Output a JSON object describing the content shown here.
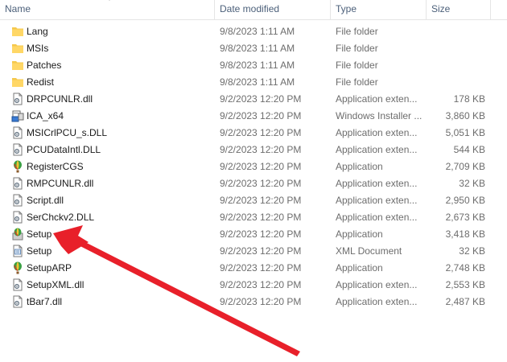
{
  "columns": {
    "name": "Name",
    "date": "Date modified",
    "type": "Type",
    "size": "Size"
  },
  "colors": {
    "folder": "#f5c84c",
    "arrow": "#e8202a",
    "header_text": "#4c607a"
  },
  "files": [
    {
      "name": "Lang",
      "date": "9/8/2023 1:11 AM",
      "type": "File folder",
      "size": "",
      "icon": "folder-icon"
    },
    {
      "name": "MSIs",
      "date": "9/8/2023 1:11 AM",
      "type": "File folder",
      "size": "",
      "icon": "folder-icon"
    },
    {
      "name": "Patches",
      "date": "9/8/2023 1:11 AM",
      "type": "File folder",
      "size": "",
      "icon": "folder-icon"
    },
    {
      "name": "Redist",
      "date": "9/8/2023 1:11 AM",
      "type": "File folder",
      "size": "",
      "icon": "folder-icon"
    },
    {
      "name": "DRPCUNLR.dll",
      "date": "9/2/2023 12:20 PM",
      "type": "Application exten...",
      "size": "178 KB",
      "icon": "dll-file-icon"
    },
    {
      "name": "ICA_x64",
      "date": "9/2/2023 12:20 PM",
      "type": "Windows Installer ...",
      "size": "3,860 KB",
      "icon": "installer-icon"
    },
    {
      "name": "MSICrlPCU_s.DLL",
      "date": "9/2/2023 12:20 PM",
      "type": "Application exten...",
      "size": "5,051 KB",
      "icon": "dll-file-icon"
    },
    {
      "name": "PCUDataIntl.DLL",
      "date": "9/2/2023 12:20 PM",
      "type": "Application exten...",
      "size": "544 KB",
      "icon": "dll-file-icon"
    },
    {
      "name": "RegisterCGS",
      "date": "9/2/2023 12:20 PM",
      "type": "Application",
      "size": "2,709 KB",
      "icon": "balloon-app-icon"
    },
    {
      "name": "RMPCUNLR.dll",
      "date": "9/2/2023 12:20 PM",
      "type": "Application exten...",
      "size": "32 KB",
      "icon": "dll-file-icon"
    },
    {
      "name": "Script.dll",
      "date": "9/2/2023 12:20 PM",
      "type": "Application exten...",
      "size": "2,950 KB",
      "icon": "dll-file-icon"
    },
    {
      "name": "SerChckv2.DLL",
      "date": "9/2/2023 12:20 PM",
      "type": "Application exten...",
      "size": "2,673 KB",
      "icon": "dll-file-icon"
    },
    {
      "name": "Setup",
      "date": "9/2/2023 12:20 PM",
      "type": "Application",
      "size": "3,418 KB",
      "icon": "setup-app-icon"
    },
    {
      "name": "Setup",
      "date": "9/2/2023 12:20 PM",
      "type": "XML Document",
      "size": "32 KB",
      "icon": "xml-file-icon"
    },
    {
      "name": "SetupARP",
      "date": "9/2/2023 12:20 PM",
      "type": "Application",
      "size": "2,748 KB",
      "icon": "balloon-app-icon"
    },
    {
      "name": "SetupXML.dll",
      "date": "9/2/2023 12:20 PM",
      "type": "Application exten...",
      "size": "2,553 KB",
      "icon": "dll-file-icon"
    },
    {
      "name": "tBar7.dll",
      "date": "9/2/2023 12:20 PM",
      "type": "Application exten...",
      "size": "2,487 KB",
      "icon": "dll-file-icon"
    }
  ]
}
